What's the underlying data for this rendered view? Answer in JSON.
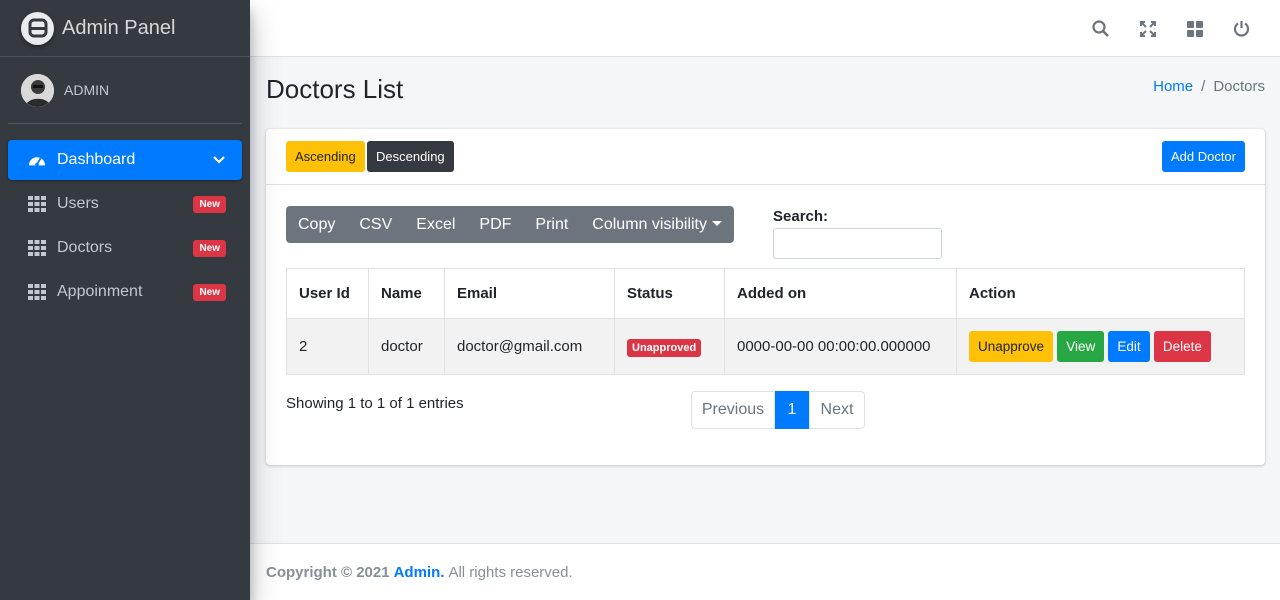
{
  "sidebar": {
    "brand": "Admin Panel",
    "user": "ADMIN",
    "items": [
      {
        "label": "Dashboard",
        "icon": "tachometer-icon",
        "active": true
      },
      {
        "label": "Users",
        "badge": "New",
        "icon": "grid-icon"
      },
      {
        "label": "Doctors",
        "badge": "New",
        "icon": "grid-icon"
      },
      {
        "label": "Appoinment",
        "badge": "New",
        "icon": "grid-icon"
      }
    ]
  },
  "topbar": {
    "icons": [
      "search-icon",
      "expand-icon",
      "th-large-icon",
      "power-icon"
    ]
  },
  "header": {
    "title": "Doctors List",
    "breadcrumb": {
      "home": "Home",
      "separator": "/",
      "current": "Doctors"
    }
  },
  "card": {
    "ascending_label": "Ascending",
    "descending_label": "Descending",
    "add_label": "Add Doctor",
    "dt_buttons": [
      "Copy",
      "CSV",
      "Excel",
      "PDF",
      "Print",
      "Column visibility"
    ],
    "search_label": "Search:",
    "search_value": "",
    "columns": [
      "User Id",
      "Name",
      "Email",
      "Status",
      "Added on",
      "Action"
    ],
    "rows": [
      {
        "user_id": "2",
        "name": "doctor",
        "email": "doctor@gmail.com",
        "status": "Unapproved",
        "added_on": "0000-00-00 00:00:00.000000",
        "actions": [
          "Unapprove",
          "View",
          "Edit",
          "Delete"
        ]
      }
    ],
    "info": "Showing 1 to 1 of 1 entries",
    "pagination": {
      "previous": "Previous",
      "current": "1",
      "next": "Next"
    }
  },
  "footer": {
    "prefix": "Copyright © 2021",
    "brand": "Admin.",
    "suffix": "All rights reserved."
  },
  "colors": {
    "sidebar_bg": "#343a40",
    "primary": "#007bff",
    "warning": "#ffc107",
    "success": "#28a745",
    "danger": "#dc3545",
    "secondary": "#6c757d"
  }
}
